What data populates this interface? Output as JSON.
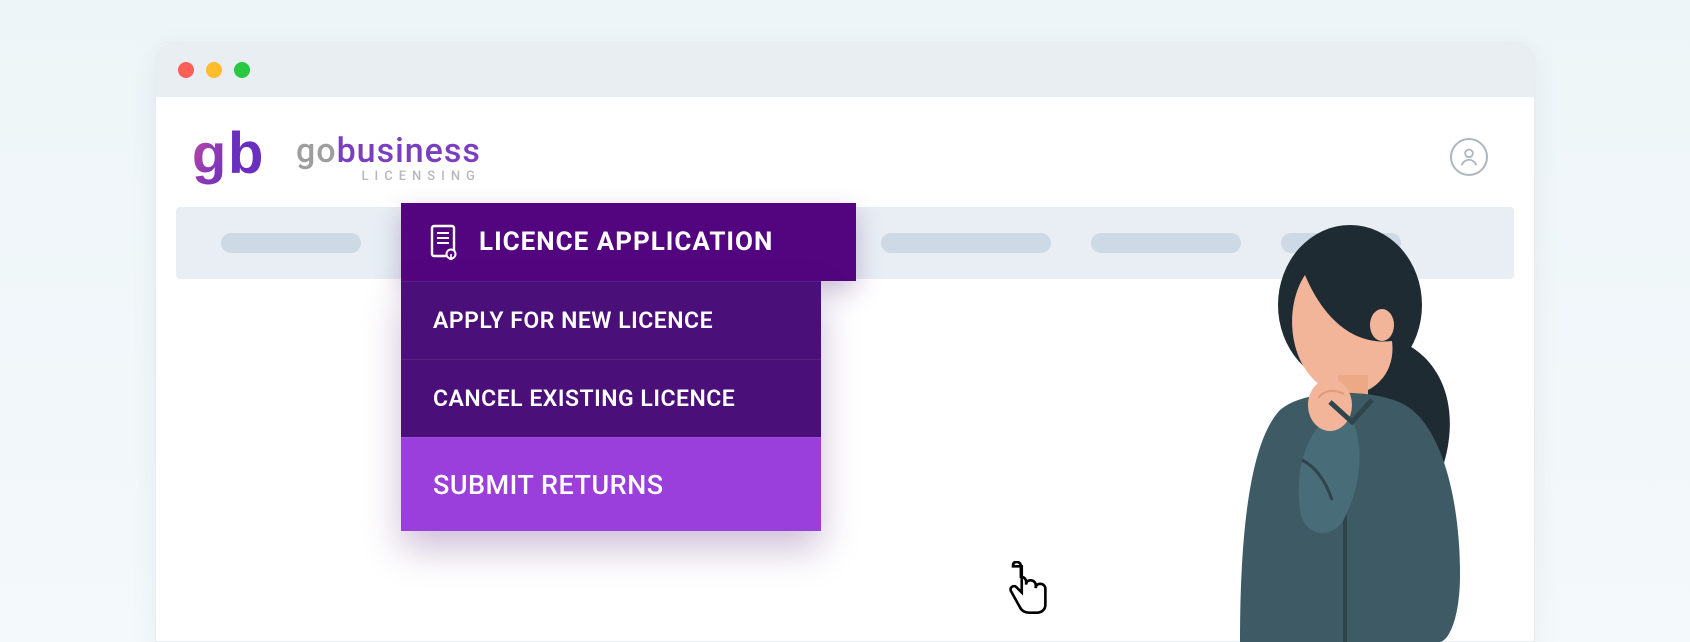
{
  "brand": {
    "name_part1": "go",
    "name_part2": "business",
    "subtitle": "LICENSING"
  },
  "nav": {
    "active_tab_label": "LICENCE APPLICATION",
    "dropdown": [
      {
        "label": "APPLY FOR NEW LICENCE",
        "state": "normal"
      },
      {
        "label": "CANCEL EXISTING LICENCE",
        "state": "normal"
      },
      {
        "label": "SUBMIT RETURNS",
        "state": "hover"
      }
    ]
  },
  "icons": {
    "document": "document-icon",
    "profile": "profile-icon",
    "cursor": "pointer-cursor-icon"
  },
  "colors": {
    "menu_dark": "#4b0f7a",
    "menu_darker": "#52057f",
    "menu_hover": "#9a3fdc",
    "nav_bg": "#e8eef4",
    "nav_skeleton": "#cdd9e4"
  }
}
